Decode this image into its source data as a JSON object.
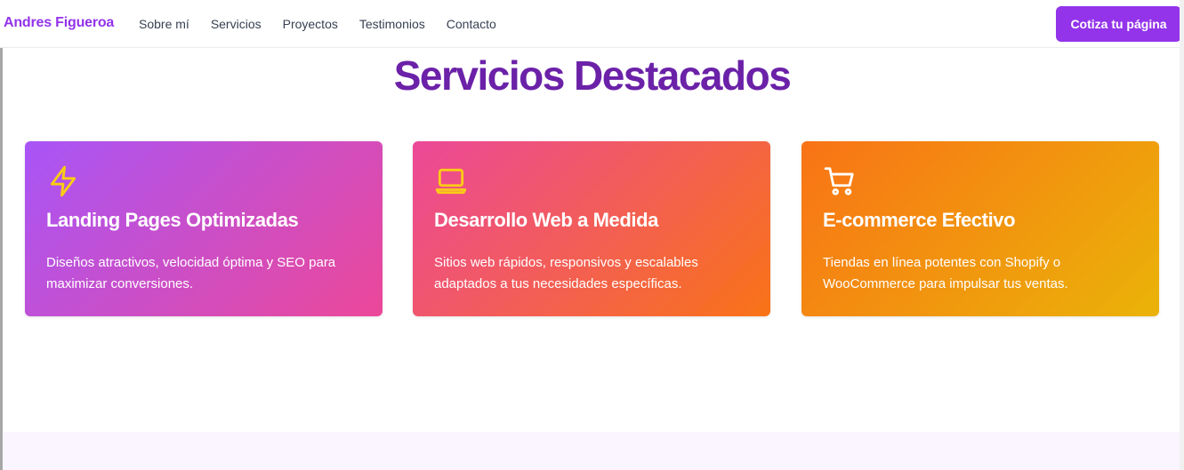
{
  "navbar": {
    "brand": "Andres Figueroa",
    "links": [
      "Sobre mí",
      "Servicios",
      "Proyectos",
      "Testimonios",
      "Contacto"
    ],
    "cta_label": "Cotiza tu página"
  },
  "section": {
    "title": "Servicios Destacados"
  },
  "cards": [
    {
      "icon": "lightning-icon",
      "title": "Landing Pages Optimizadas",
      "description": "Diseños atractivos, velocidad óptima y SEO para maximizar conversiones."
    },
    {
      "icon": "laptop-icon",
      "title": "Desarrollo Web a Medida",
      "description": "Sitios web rápidos, responsivos y escalables adaptados a tus necesidades específicas."
    },
    {
      "icon": "shopping-cart-icon",
      "title": "E-commerce Efectivo",
      "description": "Tiendas en línea potentes con Shopify o WooCommerce para impulsar tus ventas."
    }
  ],
  "colors": {
    "brand": "#9333ea",
    "title": "#6b21a8",
    "icon_stroke": "#facc15",
    "card1_gradient": [
      "#a855f7",
      "#ec4899"
    ],
    "card2_gradient": [
      "#ec4899",
      "#f97316"
    ],
    "card3_gradient": [
      "#f97316",
      "#eab308"
    ]
  }
}
